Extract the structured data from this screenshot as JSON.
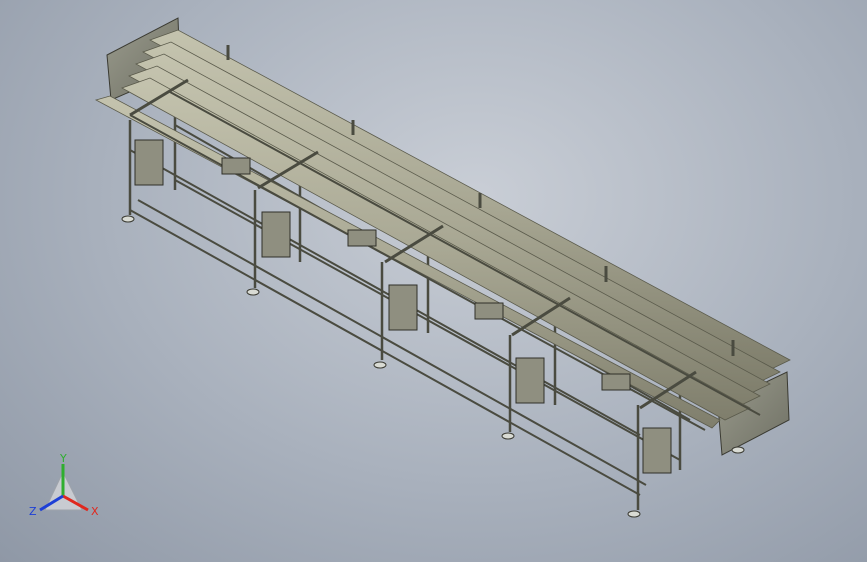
{
  "view": {
    "background_inner": "#c9ced6",
    "background_outer": "#8f98a6"
  },
  "model": {
    "frame_color": "#6b6c5f",
    "roller_color": "#a9a894",
    "roller_shadow": "#7f7e6c",
    "panel_color": "#8a8b7e",
    "legs": 6
  },
  "triad": {
    "x_label": "X",
    "y_label": "Y",
    "z_label": "Z",
    "x_color": "#e0281e",
    "y_color": "#2fae2f",
    "z_color": "#1d3fd6"
  }
}
